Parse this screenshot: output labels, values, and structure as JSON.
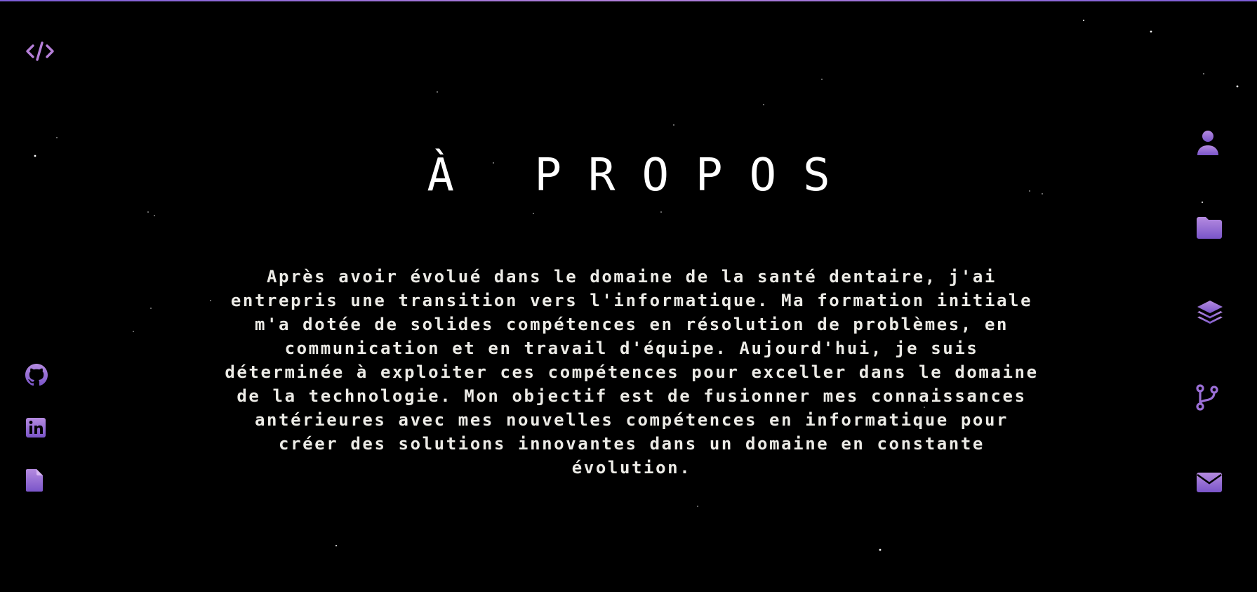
{
  "header": {
    "logo_icon": "code-icon"
  },
  "about": {
    "title": "À PROPOS",
    "paragraph": "Après avoir évolué dans le domaine de la santé dentaire, j'ai entrepris une transition vers l'informatique. Ma formation initiale m'a dotée de solides compétences en résolution de problèmes, en communication et en travail d'équipe. Aujourd'hui, je suis déterminée à exploiter ces compétences pour exceller dans le domaine de la technologie. Mon objectif est de fusionner mes connaissances antérieures avec mes nouvelles compétences en informatique pour créer des solutions innovantes dans un domaine en constante évolution."
  },
  "social_links": [
    {
      "icon": "github-icon"
    },
    {
      "icon": "linkedin-icon"
    },
    {
      "icon": "document-icon"
    }
  ],
  "section_nav": [
    {
      "icon": "user-icon"
    },
    {
      "icon": "folder-icon"
    },
    {
      "icon": "layers-icon"
    },
    {
      "icon": "git-branch-icon"
    },
    {
      "icon": "envelope-icon"
    }
  ],
  "colors": {
    "background": "#000000",
    "accent": "#9b6fd6",
    "accent_light": "#b58be0",
    "accent_dark": "#7a55c9",
    "text": "#ecebe6",
    "title": "#ffffff"
  }
}
